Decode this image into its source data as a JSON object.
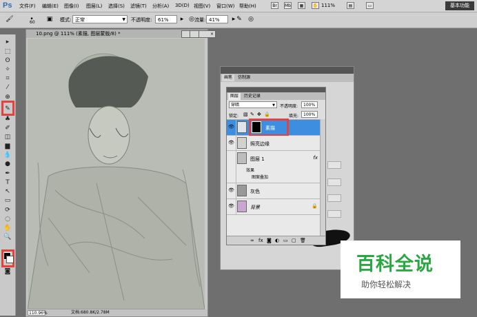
{
  "menubar": {
    "logo": "Ps",
    "items": [
      "文件(F)",
      "编辑(E)",
      "图像(I)",
      "图层(L)",
      "选择(S)",
      "滤镜(T)",
      "分析(A)",
      "3D(D)",
      "视图(V)",
      "窗口(W)",
      "帮助(H)"
    ],
    "zoom": "111%",
    "workspace_button": "基本功能"
  },
  "options": {
    "brush_size": "60",
    "mode_label": "模式:",
    "mode_value": "正常",
    "opacity_label": "不透明度:",
    "opacity_value": "61%",
    "flow_label": "流量:",
    "flow_value": "41%"
  },
  "document": {
    "title": "10.png @ 111% (素描, 图层蒙版/8) *",
    "zoom_field": "110.96%",
    "doc_info": "文档:680.8K/2.78M"
  },
  "panel_back": {
    "tabs": [
      "画笔",
      "仿制源"
    ]
  },
  "layers_panel": {
    "tabs": [
      "图层",
      "历史记录"
    ],
    "blend_mode": "穿暗",
    "opacity_label": "不透明度:",
    "opacity_value": "100%",
    "lock_label": "锁定:",
    "fill_label": "填充:",
    "fill_value": "100%",
    "layers": [
      {
        "name": "素描",
        "selected": true,
        "visible": true
      },
      {
        "name": "照亮边缘",
        "selected": false,
        "visible": true
      },
      {
        "name": "图层 1",
        "selected": false,
        "visible": false,
        "fx": "fx"
      },
      {
        "name": "灰色",
        "selected": false,
        "visible": true
      },
      {
        "name": "背景",
        "selected": false,
        "visible": true
      }
    ],
    "effects_label": "效果",
    "effect_item": "图案叠加"
  },
  "brand": {
    "main": "百科全说",
    "sub": "助你轻松解决"
  },
  "colors": {
    "highlight": "#e8413c",
    "selected_layer": "#3d8ee0",
    "brand_green": "#2aa840"
  }
}
